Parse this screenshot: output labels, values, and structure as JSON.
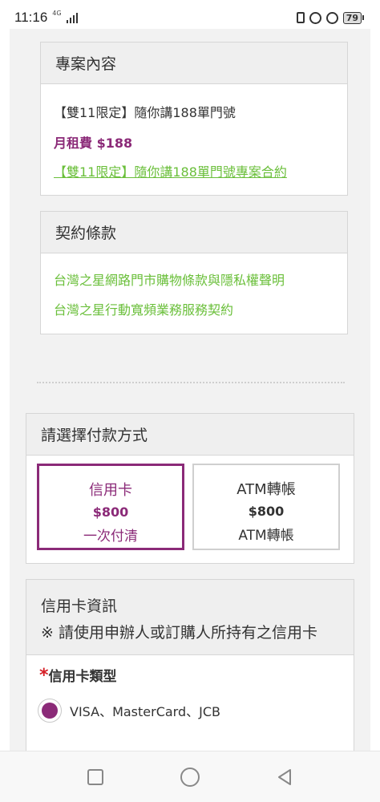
{
  "status": {
    "time": "11:16",
    "network": "4G",
    "battery": "79"
  },
  "project": {
    "title": "專案內容",
    "plan_name": "【雙11限定】隨你講188單門號",
    "monthly_fee": "月租費 $188",
    "contract_link": "【雙11限定】隨你講188單門號專案合約"
  },
  "terms": {
    "title": "契約條款",
    "links": [
      "台灣之星網路門市購物條款與隱私權聲明",
      "台灣之星行動寬頻業務服務契約"
    ]
  },
  "payment": {
    "title": "請選擇付款方式",
    "options": [
      {
        "title": "信用卡",
        "price": "$800",
        "sub": "一次付清"
      },
      {
        "title": "ATM轉帳",
        "price": "$800",
        "sub": "ATM轉帳"
      }
    ]
  },
  "card_info": {
    "title": "信用卡資訊",
    "note": "※ 請使用申辦人或訂購人所持有之信用卡",
    "required_mark": "*",
    "type_label": "信用卡類型",
    "type_option": "VISA、MasterCard、JCB"
  },
  "colors": {
    "accent": "#8b2a78",
    "link": "#6abf3a",
    "required": "#d61f26"
  }
}
